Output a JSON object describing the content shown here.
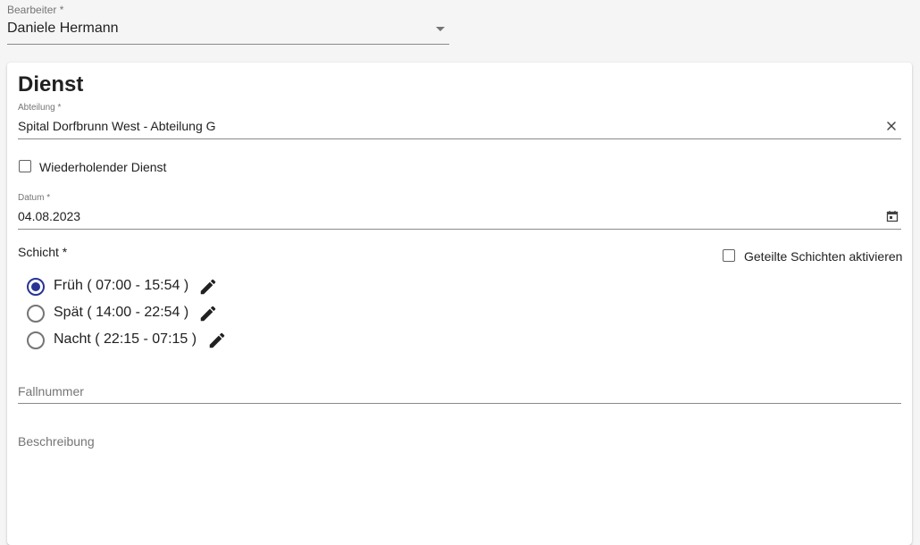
{
  "worker": {
    "label": "Bearbeiter *",
    "value": "Daniele Hermann"
  },
  "card": {
    "title": "Dienst",
    "department": {
      "label": "Abteilung *",
      "value": "Spital Dorfbrunn West - Abteilung G"
    },
    "recurring": {
      "label": "Wiederholender Dienst",
      "checked": false
    },
    "date": {
      "label": "Datum *",
      "value": "04.08.2023"
    },
    "shift": {
      "label": "Schicht *",
      "split_label": "Geteilte Schichten aktivieren",
      "split_checked": false,
      "options": [
        {
          "label": "Früh ( 07:00 - 15:54 )",
          "selected": true
        },
        {
          "label": "Spät ( 14:00 - 22:54 )",
          "selected": false
        },
        {
          "label": "Nacht ( 22:15 - 07:15 )",
          "selected": false
        }
      ]
    },
    "case_number": {
      "placeholder": "Fallnummer"
    },
    "description": {
      "placeholder": "Beschreibung"
    }
  },
  "colors": {
    "accent": "#283593",
    "card_bg": "#ffffff",
    "page_bg": "#f5f5f5"
  }
}
